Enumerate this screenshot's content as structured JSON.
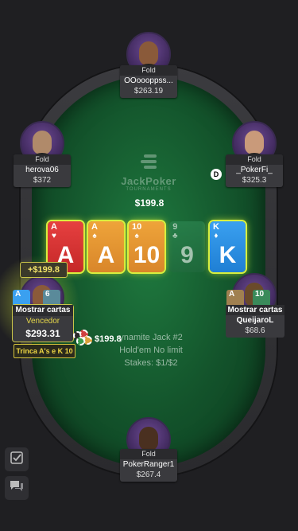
{
  "table": {
    "logo_text": "JackPoker",
    "logo_sub": "TOURNAMENTS",
    "pot": "$199.8",
    "info_lines": [
      "ynamite Jack #2",
      "Hold'em No limit",
      "Stakes: $1/$2"
    ]
  },
  "board": [
    {
      "rank": "A",
      "suit": "♥",
      "color": "red",
      "highlighted": true
    },
    {
      "rank": "A",
      "suit": "♠",
      "color": "orange",
      "highlighted": true
    },
    {
      "rank": "10",
      "suit": "♠",
      "color": "orange",
      "highlighted": true
    },
    {
      "rank": "9",
      "suit": "♣",
      "color": "green",
      "highlighted": false
    },
    {
      "rank": "K",
      "suit": "♦",
      "color": "blue",
      "highlighted": true
    }
  ],
  "seats": {
    "top": {
      "status": "Fold",
      "name": "OOoooppss...",
      "stack": "$263.19"
    },
    "left_upper": {
      "status": "Fold",
      "name": "herova06",
      "stack": "$372"
    },
    "right_upper": {
      "status": "Fold",
      "name": "_PokerFi_",
      "stack": "$325.3"
    },
    "bottom": {
      "status": "Fold",
      "name": "PokerRanger1",
      "stack": "$267.4"
    },
    "right_lower": {
      "status": "Mostrar cartas",
      "name": "QueijaroL",
      "stack": "$68.6",
      "cards": [
        "A",
        "10"
      ]
    },
    "winner": {
      "win_amount": "+$199.8",
      "status": "Mostrar cartas",
      "label": "Vencedor",
      "stack": "$293.31",
      "hand_description": "Trinca A's e K 10",
      "cards": [
        "A",
        "6"
      ],
      "bet_amount": "$199.8"
    }
  },
  "dealer_button": "D",
  "colors": {
    "felt": "#13532b",
    "highlight": "#d8ef3e",
    "winner_text": "#e7d84a"
  },
  "side_buttons": [
    {
      "icon": "checklist-icon"
    },
    {
      "icon": "chat-icon"
    }
  ]
}
